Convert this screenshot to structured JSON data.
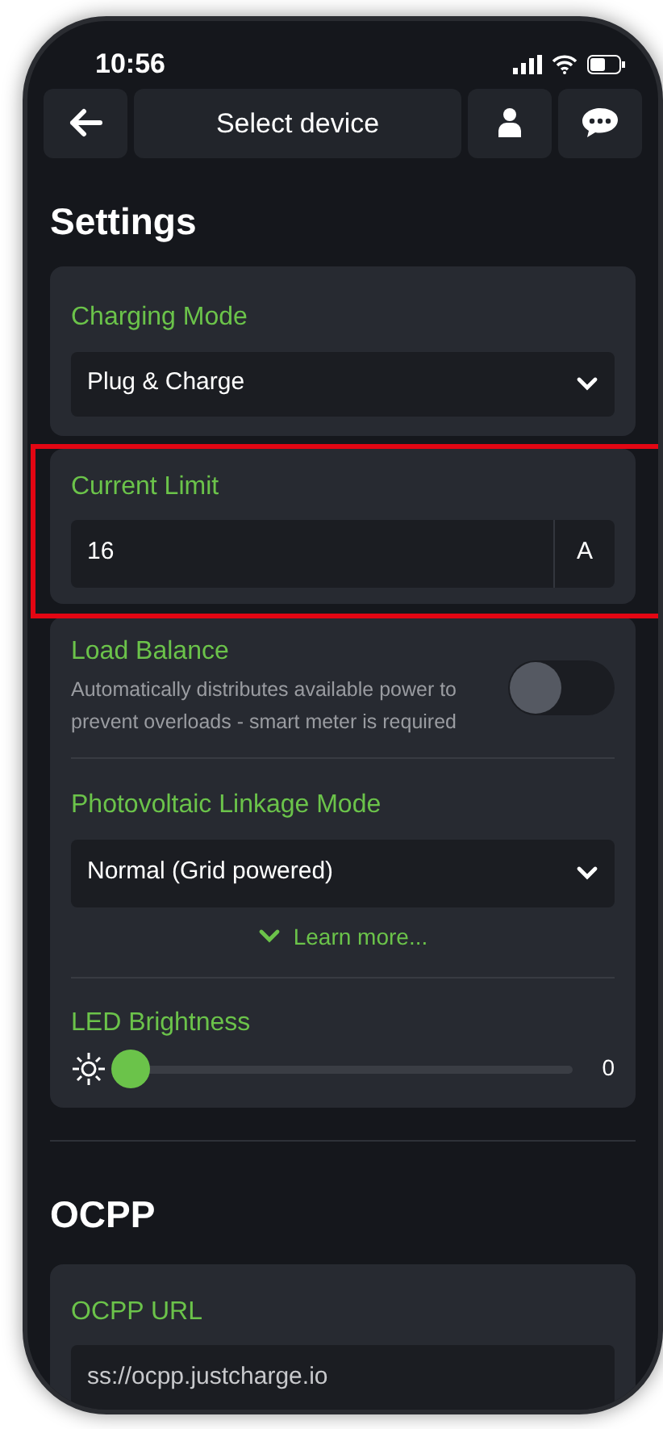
{
  "status_bar": {
    "time": "10:56"
  },
  "nav": {
    "title": "Select device"
  },
  "settings": {
    "title": "Settings",
    "charging_mode": {
      "label": "Charging Mode",
      "value": "Plug & Charge"
    },
    "current_limit": {
      "label": "Current Limit",
      "value": "16",
      "unit": "A",
      "highlighted": true
    },
    "load_balance": {
      "label": "Load Balance",
      "description": "Automatically distributes available power to prevent overloads - smart meter is required",
      "on": false
    },
    "pv_mode": {
      "label": "Photovoltaic Linkage Mode",
      "value": "Normal (Grid powered)",
      "learn_more": "Learn more..."
    },
    "led_brightness": {
      "label": "LED Brightness",
      "level": 0,
      "reading": "0"
    }
  },
  "ocpp": {
    "title": "OCPP",
    "url_label": "OCPP URL",
    "url_value": "ss://ocpp.justcharge.io"
  }
}
